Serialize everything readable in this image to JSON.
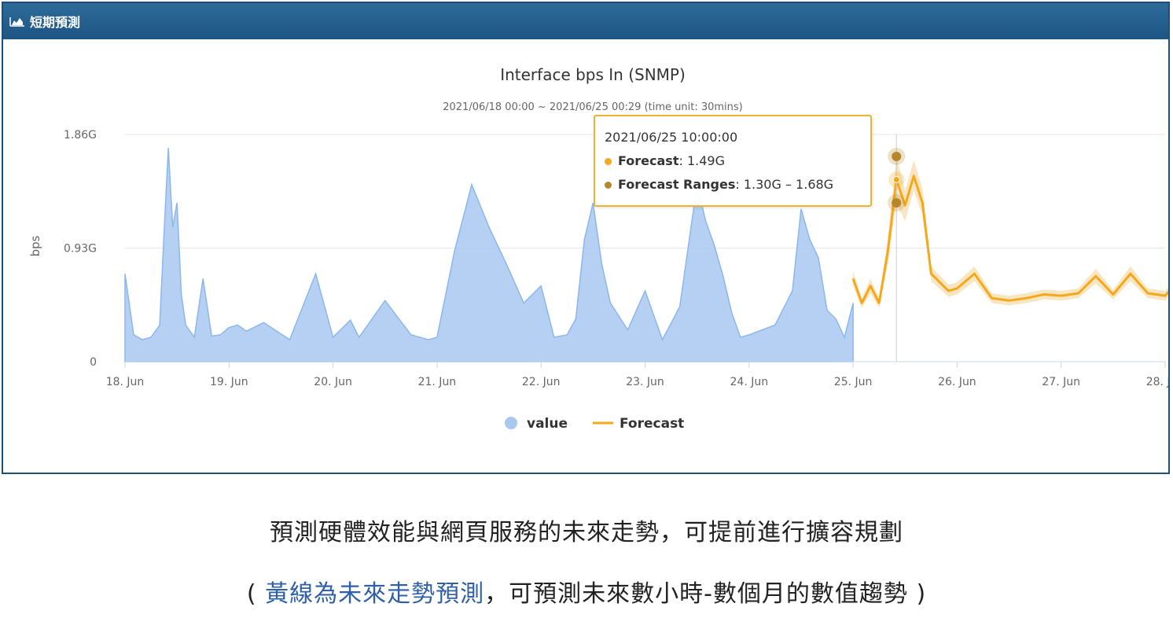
{
  "panel": {
    "title": "短期預測",
    "title_icon": "area-chart-icon",
    "header_color": "#1d5583"
  },
  "chart_data": {
    "type": "area",
    "title": "Interface bps In (SNMP)",
    "subtitle": "2021/06/18 00:00 ~ 2021/06/25 00:29 (time unit: 30mins)",
    "ylabel": "bps",
    "y_ticks": [
      "0",
      "0.93G",
      "1.86G"
    ],
    "ylim": [
      0,
      1.86
    ],
    "x_ticks": [
      "18. Jun",
      "19. Jun",
      "20. Jun",
      "21. Jun",
      "22. Jun",
      "23. Jun",
      "24. Jun",
      "25. Jun",
      "26. Jun",
      "27. Jun",
      "28. Jun"
    ],
    "grid": true,
    "legend_position": "bottom",
    "series": [
      {
        "name": "value",
        "type": "area",
        "color": "#a8c8f0",
        "x": [
          "2021-06-18 00:00",
          "2021-06-18 02:00",
          "2021-06-18 04:00",
          "2021-06-18 06:00",
          "2021-06-18 08:00",
          "2021-06-18 09:00",
          "2021-06-18 10:00",
          "2021-06-18 11:00",
          "2021-06-18 12:00",
          "2021-06-18 13:00",
          "2021-06-18 14:00",
          "2021-06-18 16:00",
          "2021-06-18 18:00",
          "2021-06-18 20:00",
          "2021-06-18 22:00",
          "2021-06-19 00:00",
          "2021-06-19 02:00",
          "2021-06-19 04:00",
          "2021-06-19 08:00",
          "2021-06-19 14:00",
          "2021-06-19 20:00",
          "2021-06-20 00:00",
          "2021-06-20 04:00",
          "2021-06-20 06:00",
          "2021-06-20 12:00",
          "2021-06-20 18:00",
          "2021-06-20 22:00",
          "2021-06-21 00:00",
          "2021-06-21 04:00",
          "2021-06-21 08:00",
          "2021-06-21 12:00",
          "2021-06-21 16:00",
          "2021-06-21 20:00",
          "2021-06-22 00:00",
          "2021-06-22 03:00",
          "2021-06-22 06:00",
          "2021-06-22 08:00",
          "2021-06-22 10:00",
          "2021-06-22 12:00",
          "2021-06-22 14:00",
          "2021-06-22 16:00",
          "2021-06-22 20:00",
          "2021-06-23 00:00",
          "2021-06-23 04:00",
          "2021-06-23 08:00",
          "2021-06-23 12:00",
          "2021-06-23 14:00",
          "2021-06-23 16:00",
          "2021-06-23 18:00",
          "2021-06-23 20:00",
          "2021-06-23 22:00",
          "2021-06-24 00:00",
          "2021-06-24 06:00",
          "2021-06-24 10:00",
          "2021-06-24 12:00",
          "2021-06-24 14:00",
          "2021-06-24 16:00",
          "2021-06-24 18:00",
          "2021-06-24 20:00",
          "2021-06-24 22:00",
          "2021-06-25 00:00"
        ],
        "values": [
          0.72,
          0.22,
          0.18,
          0.2,
          0.3,
          1.05,
          1.75,
          1.1,
          1.3,
          0.55,
          0.3,
          0.2,
          0.68,
          0.21,
          0.22,
          0.28,
          0.3,
          0.25,
          0.32,
          0.18,
          0.72,
          0.2,
          0.34,
          0.2,
          0.5,
          0.22,
          0.18,
          0.2,
          0.9,
          1.45,
          1.1,
          0.8,
          0.48,
          0.62,
          0.2,
          0.22,
          0.35,
          1.0,
          1.3,
          0.8,
          0.48,
          0.26,
          0.58,
          0.18,
          0.45,
          1.45,
          1.15,
          0.95,
          0.7,
          0.4,
          0.2,
          0.22,
          0.3,
          0.58,
          1.25,
          1.0,
          0.85,
          0.42,
          0.35,
          0.2,
          0.48
        ]
      },
      {
        "name": "Forecast",
        "type": "line",
        "color": "#f6a81a",
        "range_color": "#f0c878",
        "x": [
          "2021-06-25 00:00",
          "2021-06-25 02:00",
          "2021-06-25 04:00",
          "2021-06-25 06:00",
          "2021-06-25 08:00",
          "2021-06-25 10:00",
          "2021-06-25 12:00",
          "2021-06-25 14:00",
          "2021-06-25 16:00",
          "2021-06-25 18:00",
          "2021-06-25 22:00",
          "2021-06-26 00:00",
          "2021-06-26 04:00",
          "2021-06-26 08:00",
          "2021-06-26 12:00",
          "2021-06-26 16:00",
          "2021-06-26 20:00",
          "2021-06-27 00:00",
          "2021-06-27 04:00",
          "2021-06-27 08:00",
          "2021-06-27 12:00",
          "2021-06-27 16:00",
          "2021-06-27 20:00",
          "2021-06-28 00:00",
          "2021-06-28 04:00"
        ],
        "values": [
          0.68,
          0.48,
          0.62,
          0.48,
          0.9,
          1.49,
          1.28,
          1.52,
          1.3,
          0.72,
          0.58,
          0.6,
          0.72,
          0.52,
          0.5,
          0.52,
          0.55,
          0.54,
          0.56,
          0.7,
          0.55,
          0.72,
          0.56,
          0.54,
          0.7
        ],
        "ranges": [
          [
            0.62,
            0.74
          ],
          [
            0.44,
            0.52
          ],
          [
            0.56,
            0.68
          ],
          [
            0.44,
            0.52
          ],
          [
            0.8,
            1.0
          ],
          [
            1.3,
            1.68
          ],
          [
            1.15,
            1.4
          ],
          [
            1.4,
            1.65
          ],
          [
            1.2,
            1.42
          ],
          [
            0.66,
            0.78
          ],
          [
            0.53,
            0.63
          ],
          [
            0.55,
            0.65
          ],
          [
            0.66,
            0.78
          ],
          [
            0.48,
            0.56
          ],
          [
            0.46,
            0.54
          ],
          [
            0.48,
            0.56
          ],
          [
            0.51,
            0.59
          ],
          [
            0.5,
            0.58
          ],
          [
            0.52,
            0.6
          ],
          [
            0.64,
            0.76
          ],
          [
            0.51,
            0.59
          ],
          [
            0.66,
            0.78
          ],
          [
            0.52,
            0.6
          ],
          [
            0.5,
            0.58
          ],
          [
            0.64,
            0.76
          ]
        ]
      }
    ],
    "tooltip": {
      "time": "2021/06/25 10:00:00",
      "forecast_label": "Forecast",
      "forecast_value": ": 1.49G",
      "range_label": "Forecast Ranges",
      "range_value": ": 1.30G – 1.68G",
      "forecast_color": "#f6a81a",
      "range_color": "#b8862a"
    }
  },
  "caption": {
    "line1": "預測硬體效能與網頁服務的未來走勢，可提前進行擴容規劃",
    "line2_open": "( ",
    "line2_highlight": "黃線為未來走勢預測",
    "line2_rest": "，可預測未來數小時-數個月的數值趨勢 )"
  }
}
